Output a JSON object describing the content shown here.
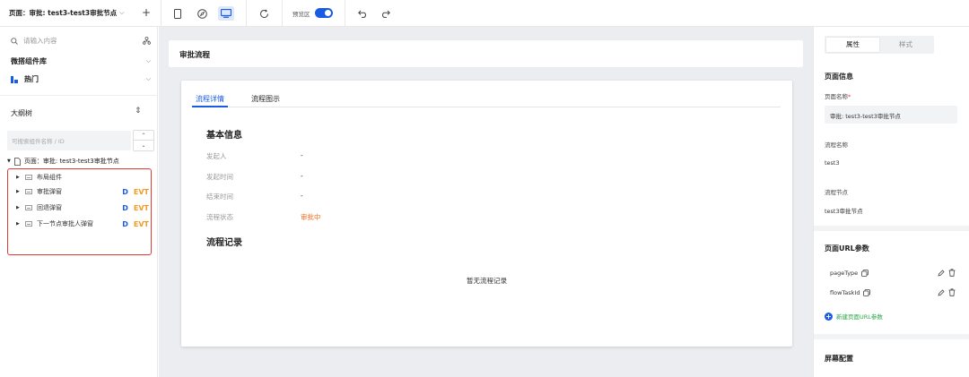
{
  "topbar": {
    "page_select": "页面：审批: test3-test3审批节点",
    "add": "+",
    "preview_label": "预览区"
  },
  "left": {
    "search_placeholder": "请输入内容",
    "lib_title": "微搭组件库",
    "hot_title": "热门",
    "outline_title": "大纲树",
    "tree_search_placeholder": "可搜索组件名称 / ID",
    "root_label": "页面：审批: test3-test3审批节点",
    "tree_items": [
      {
        "label": "布局组件",
        "d": "",
        "evt": ""
      },
      {
        "label": "审批弹窗",
        "d": "D",
        "evt": "EVT"
      },
      {
        "label": "回退弹窗",
        "d": "D",
        "evt": "EVT"
      },
      {
        "label": "下一节点审批人弹窗",
        "d": "D",
        "evt": "EVT"
      }
    ]
  },
  "canvas": {
    "page_title": "审批流程",
    "tabs": [
      "流程详情",
      "流程图示"
    ],
    "basic_title": "基本信息",
    "info": [
      {
        "k": "发起人",
        "v": "-"
      },
      {
        "k": "发起时间",
        "v": "-"
      },
      {
        "k": "结束时间",
        "v": "-"
      },
      {
        "k": "流程状态",
        "v": "审批中"
      }
    ],
    "record_title": "流程记录",
    "empty_text": "暂无流程记录"
  },
  "right": {
    "tabs": [
      "属性",
      "样式"
    ],
    "page_info_title": "页面信息",
    "page_name_label": "页面名称",
    "page_name_required": "*",
    "page_name_value": "审批: test3-test3审批节点",
    "flow_name_label": "流程名称",
    "flow_name_value": "test3",
    "flow_node_label": "流程节点",
    "flow_node_value": "test3审批节点",
    "url_params_title": "页面URL参数",
    "params": [
      "pageType",
      "flowTaskId"
    ],
    "add_param": "新建页面URL参数",
    "screen_title": "屏幕配置"
  },
  "colors": {
    "accent": "#1a5be6",
    "highlight_border": "#e53935",
    "status": "#f26b21",
    "evt": "#f59a23",
    "add_link": "#27a844"
  }
}
